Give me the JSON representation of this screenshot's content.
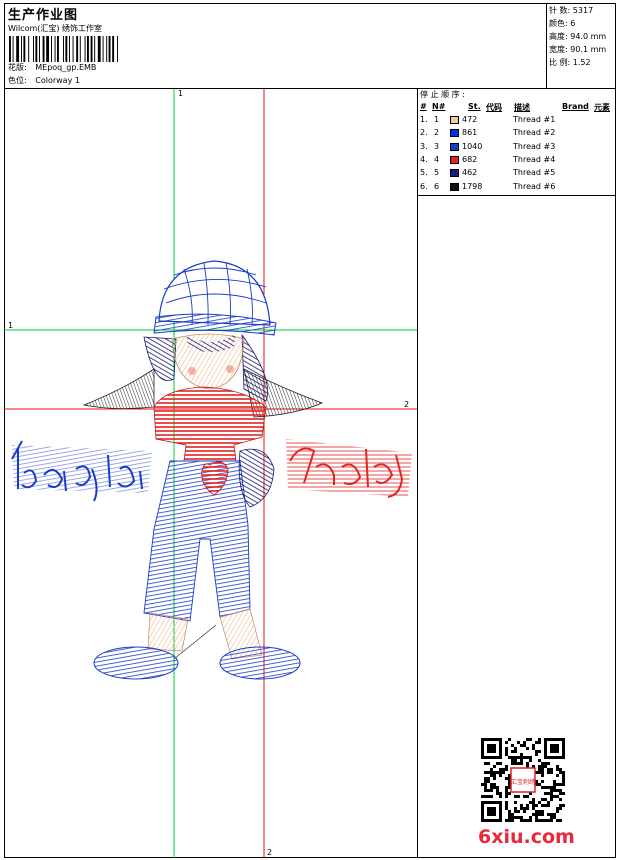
{
  "header": {
    "title": "生产作业图",
    "company": "Wilcom(汇宝) 绣饰工作室",
    "pattern_label": "花版:",
    "pattern_value": "MEpoq_gp.EMB",
    "colorway_label": "色位:",
    "colorway_value": "Colorway 1"
  },
  "stats": [
    {
      "label": "针 数:",
      "value": "5317"
    },
    {
      "label": "颜色:",
      "value": "6"
    },
    {
      "label": "高度:",
      "value": "94.0 mm"
    },
    {
      "label": "宽度:",
      "value": "90.1 mm"
    },
    {
      "label": "比 例:",
      "value": "1.52"
    }
  ],
  "stop_panel": {
    "title": "停 止 顺 序 :",
    "headers": {
      "num": "#",
      "n": "N#",
      "st": "St.",
      "code": "代码",
      "desc": "描述",
      "brand": "Brand",
      "element": "元素"
    },
    "rows": [
      {
        "idx": "1.",
        "n": "1",
        "color": "#f5c8a0",
        "st": "472",
        "desc": "Thread #1"
      },
      {
        "idx": "2.",
        "n": "2",
        "color": "#0033dd",
        "st": "861",
        "desc": "Thread #2"
      },
      {
        "idx": "3.",
        "n": "3",
        "color": "#1a3cc8",
        "st": "1040",
        "desc": "Thread #3"
      },
      {
        "idx": "4.",
        "n": "4",
        "color": "#e52222",
        "st": "682",
        "desc": "Thread #4"
      },
      {
        "idx": "5.",
        "n": "5",
        "color": "#1a1a80",
        "st": "462",
        "desc": "Thread #5"
      },
      {
        "idx": "6.",
        "n": "6",
        "color": "#111111",
        "st": "1798",
        "desc": "Thread #6"
      }
    ]
  },
  "guides": {
    "v1_label": "1",
    "h1_label": "1",
    "h2_label": "2",
    "v2_label": "2"
  },
  "watermark": "6xiu.com",
  "qr_stamp": "汇宝刺绣"
}
